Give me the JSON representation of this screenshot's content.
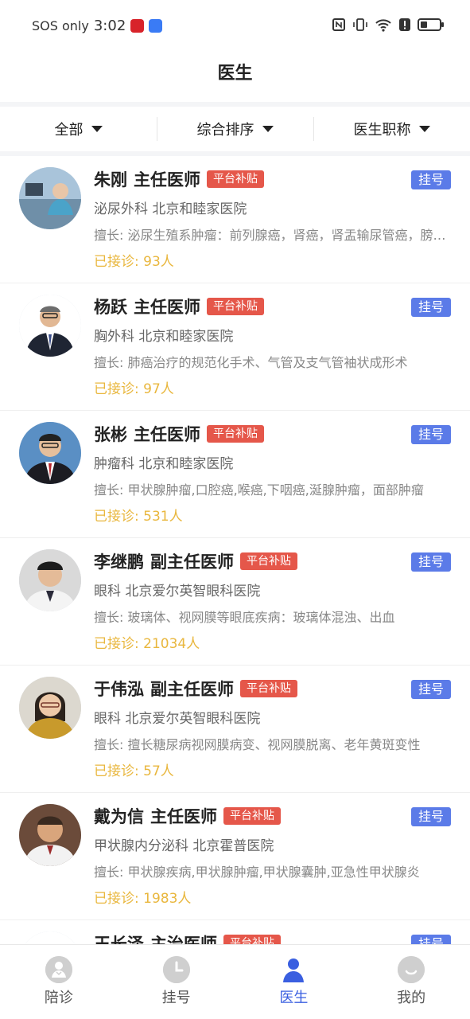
{
  "status_bar": {
    "carrier": "SOS only",
    "time": "3:02",
    "battery_level": 0.35
  },
  "header": {
    "title": "医生"
  },
  "filters": [
    {
      "label": "全部"
    },
    {
      "label": "综合排序"
    },
    {
      "label": "医生职称"
    }
  ],
  "doctors": [
    {
      "name": "朱刚",
      "title": "主任医师",
      "badge": "平台补贴",
      "action": "挂号",
      "dept_hospital": "泌尿外科 北京和睦家医院",
      "skill": "擅长: 泌尿生殖系肿瘤：前列腺癌，肾癌，肾盂输尿管癌，膀胱癌",
      "visits": "已接诊: 93人"
    },
    {
      "name": "杨跃",
      "title": "主任医师",
      "badge": "平台补贴",
      "action": "挂号",
      "dept_hospital": "胸外科 北京和睦家医院",
      "skill": "擅长: 肺癌治疗的规范化手术、气管及支气管袖状成形术",
      "visits": "已接诊: 97人"
    },
    {
      "name": "张彬",
      "title": "主任医师",
      "badge": "平台补贴",
      "action": "挂号",
      "dept_hospital": "肿瘤科 北京和睦家医院",
      "skill": "擅长: 甲状腺肿瘤,口腔癌,喉癌,下咽癌,涎腺肿瘤，面部肿瘤",
      "visits": "已接诊: 531人"
    },
    {
      "name": "李继鹏",
      "title": "副主任医师",
      "badge": "平台补贴",
      "action": "挂号",
      "dept_hospital": "眼科 北京爱尔英智眼科医院",
      "skill": "擅长: 玻璃体、视网膜等眼底疾病：玻璃体混浊、出血",
      "visits": "已接诊: 21034人"
    },
    {
      "name": "于伟泓",
      "title": "副主任医师",
      "badge": "平台补贴",
      "action": "挂号",
      "dept_hospital": "眼科 北京爱尔英智眼科医院",
      "skill": "擅长: 擅长糖尿病视网膜病变、视网膜脱离、老年黄斑变性",
      "visits": "已接诊: 57人"
    },
    {
      "name": "戴为信",
      "title": "主任医师",
      "badge": "平台补贴",
      "action": "挂号",
      "dept_hospital": "甲状腺内分泌科 北京霍普医院",
      "skill": "擅长: 甲状腺疾病,甲状腺肿瘤,甲状腺囊肿,亚急性甲状腺炎",
      "visits": "已接诊: 1983人"
    },
    {
      "name": "王长泽",
      "title": "主治医师",
      "badge": "平台补贴",
      "action": "挂号",
      "dept_hospital": "",
      "skill": "",
      "visits": ""
    }
  ],
  "bottom_nav": [
    {
      "label": "陪诊",
      "icon": "escort-icon",
      "active": false
    },
    {
      "label": "挂号",
      "icon": "clock-icon",
      "active": false
    },
    {
      "label": "医生",
      "icon": "doctor-icon",
      "active": true
    },
    {
      "label": "我的",
      "icon": "profile-icon",
      "active": false
    }
  ],
  "colors": {
    "accent": "#3a5fe0",
    "badge": "#e5574a",
    "register_button": "#5b7be8",
    "visits_text": "#e9b73e"
  }
}
